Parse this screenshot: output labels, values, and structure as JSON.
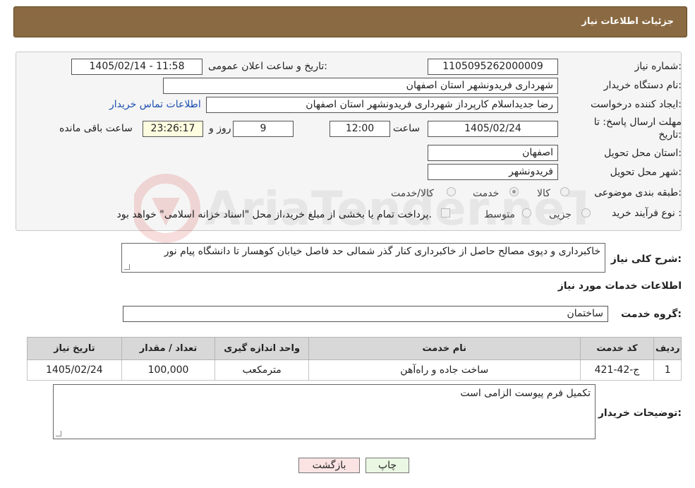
{
  "header": {
    "title": "جزئیات اطلاعات نیاز"
  },
  "form": {
    "need_number_label": "شماره نیاز:",
    "need_number": "1105095262000009",
    "announce_label": "تاریخ و ساعت اعلان عمومی:",
    "announce_value": "1405/02/14 - 11:58",
    "buyer_org_label": "نام دستگاه خریدار:",
    "buyer_org": "شهرداری فریدونشهر استان اصفهان",
    "creator_label": "ایجاد کننده درخواست:",
    "creator": "رضا جدیداسلام کارپرداز شهرداری فریدونشهر استان اصفهان",
    "contact_link": "اطلاعات تماس خریدار",
    "deadline_label_line1": "مهلت ارسال پاسخ: تا",
    "deadline_label_line2": "تاریخ:",
    "deadline_date": "1405/02/24",
    "hour_label": "ساعت",
    "deadline_time": "12:00",
    "days_value": "9",
    "days_label": "روز و",
    "remaining_time": "23:26:17",
    "remaining_label": "ساعت باقی مانده",
    "province_label": "استان محل تحویل:",
    "province": "اصفهان",
    "city_label": "شهر محل تحویل:",
    "city": "فریدونشهر",
    "category_label": "طبقه بندی موضوعی:",
    "category_options": [
      "کالا",
      "خدمت",
      "کالا/خدمت"
    ],
    "category_selected": "خدمت",
    "process_label": "نوع فرآیند خرید :",
    "process_options": [
      "جزیی",
      "متوسط"
    ],
    "process_note": "پرداخت تمام یا بخشی از مبلغ خرید،از محل \"اسناد خزانه اسلامی\" خواهد بود."
  },
  "summary": {
    "label": "شرح کلی نیاز:",
    "text": "خاکبرداری و دپوی مصالح حاصل از خاکبرداری کنار گذر شمالی حد فاصل خیابان کوهسار تا دانشگاه پیام نور"
  },
  "services": {
    "section_title": "اطلاعات خدمات مورد نیاز",
    "group_label": "گروه خدمت:",
    "group_value": "ساختمان",
    "columns": [
      "ردیف",
      "کد خدمت",
      "نام خدمت",
      "واحد اندازه گیری",
      "تعداد / مقدار",
      "تاریخ نیاز"
    ],
    "rows": [
      {
        "row": "1",
        "code": "ج-42-421",
        "name": "ساخت جاده و راه‌آهن",
        "unit": "مترمکعب",
        "qty": "100,000",
        "date": "1405/02/24"
      }
    ]
  },
  "buyer_notes": {
    "label": "توضیحات خریدار:",
    "text": "تکمیل فرم پیوست الزامی است"
  },
  "buttons": {
    "print": "چاپ",
    "back": "بازگشت"
  },
  "watermark": {
    "text": "AriaTender.neT"
  },
  "colors": {
    "header_bg": "#8a6a42",
    "link": "#1a4fb0",
    "print_btn": "#eaf7e3",
    "back_btn": "#fbe3e3"
  }
}
